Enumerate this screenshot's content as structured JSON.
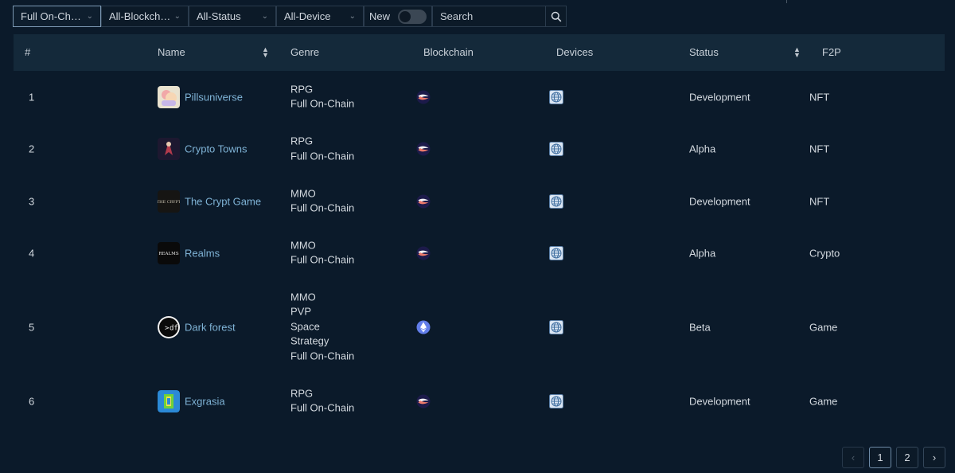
{
  "filters": {
    "category": "Full On-Chain",
    "blockchain": "All-Blockchain",
    "status": "All-Status",
    "device": "All-Device",
    "new_label": "New",
    "search_placeholder": "Search"
  },
  "table": {
    "headers": {
      "index": "#",
      "name": "Name",
      "genre": "Genre",
      "blockchain": "Blockchain",
      "devices": "Devices",
      "status": "Status",
      "f2p": "F2P"
    },
    "rows": [
      {
        "index": "1",
        "name": "Pillsuniverse",
        "genres": [
          "RPG",
          "Full On-Chain"
        ],
        "chain_icon": "starknet-icon",
        "device_icon": "web-icon",
        "status": "Development",
        "f2p": "NFT"
      },
      {
        "index": "2",
        "name": "Crypto Towns",
        "genres": [
          "RPG",
          "Full On-Chain"
        ],
        "chain_icon": "starknet-icon",
        "device_icon": "web-icon",
        "status": "Alpha",
        "f2p": "NFT"
      },
      {
        "index": "3",
        "name": "The Crypt Game",
        "genres": [
          "MMO",
          "Full On-Chain"
        ],
        "chain_icon": "starknet-icon",
        "device_icon": "web-icon",
        "status": "Development",
        "f2p": "NFT"
      },
      {
        "index": "4",
        "name": "Realms",
        "genres": [
          "MMO",
          "Full On-Chain"
        ],
        "chain_icon": "starknet-icon",
        "device_icon": "web-icon",
        "status": "Alpha",
        "f2p": "Crypto"
      },
      {
        "index": "5",
        "name": "Dark forest",
        "genres": [
          "MMO",
          "PVP",
          "Space",
          "Strategy",
          "Full On-Chain"
        ],
        "chain_icon": "ethereum-icon",
        "device_icon": "web-icon",
        "status": "Beta",
        "f2p": "Game"
      },
      {
        "index": "6",
        "name": "Exgrasia",
        "genres": [
          "RPG",
          "Full On-Chain"
        ],
        "chain_icon": "starknet-icon",
        "device_icon": "web-icon",
        "status": "Development",
        "f2p": "Game"
      }
    ]
  },
  "avatars": {
    "crypt_text": "THE CRYPT",
    "realms_text": "REALMS",
    "darkforest_text": "df"
  },
  "pagination": {
    "pages": [
      "1",
      "2"
    ],
    "current": "1",
    "prev_icon": "chevron-left-icon",
    "next_icon": "chevron-right-icon"
  }
}
